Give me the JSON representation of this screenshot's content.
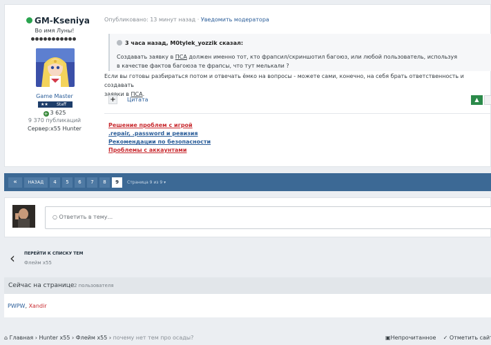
{
  "post": {
    "author": {
      "name": "GM-Kseniya",
      "subtitle": "Во имя Луны!",
      "group": "Game Master",
      "badge_label": "Staff",
      "reputation": "3 625",
      "posts": "9 370 публикаций",
      "server": "Сервер:x55 Hunter"
    },
    "meta": {
      "published": "Опубликовано: 13 минут назад",
      "separator": "·",
      "report": "Уведомить модератора"
    },
    "quote": {
      "header": "3 часа назад, M0tylek_yozzik сказал:",
      "line1_pre": "Создавать заявку в ",
      "line1_link": "ПСА",
      "line1_post": " должен именно тот, кто фрапсил/скриншотил багоюз, или любой пользователь, используя",
      "line2": "в качестве фактов багоюза  те фрапсы, что тут мелькали ?"
    },
    "text": {
      "line1": "Если вы готовы разбираться потом и отвечать ёмко на вопросы - можете сами, конечно, на себя брать ответственность и создавать",
      "line2_pre": "заявки в ",
      "line2_link": "ПСА",
      "line2_post": "."
    },
    "controls": {
      "plus": "+",
      "cite": "Цитата"
    },
    "signature": [
      "Решение проблем с игрой",
      ".repair, .password и ревизия",
      "Рекомендации по безопасности",
      "Проблемы с аккаунтами"
    ]
  },
  "pager": {
    "prev_icon": "«",
    "back_label": "НАЗАД",
    "pages": [
      "4",
      "5",
      "6",
      "7",
      "8",
      "9"
    ],
    "active_page": "9",
    "info": "Страница 9 из 9"
  },
  "reply": {
    "placeholder": "Ответить в тему..."
  },
  "nav_back": {
    "title": "ПЕРЕЙТИ К СПИСКУ ТЕМ",
    "sub": "Флейм x55"
  },
  "online": {
    "heading": "Сейчас на странице",
    "count": "2 пользователя",
    "users": [
      "PWPW",
      "Xandir"
    ]
  },
  "breadcrumb": {
    "items": [
      "Главная",
      "Hunter x55",
      "Флейм x55"
    ],
    "current": "почему нет тем про осады?",
    "unread": "Непрочитанное",
    "mark_read": "Отметить сайт про"
  },
  "colors": {
    "pager_bg": "#3c6995",
    "online_green": "#2aa44f",
    "upvote_green": "#2b8a4a"
  }
}
